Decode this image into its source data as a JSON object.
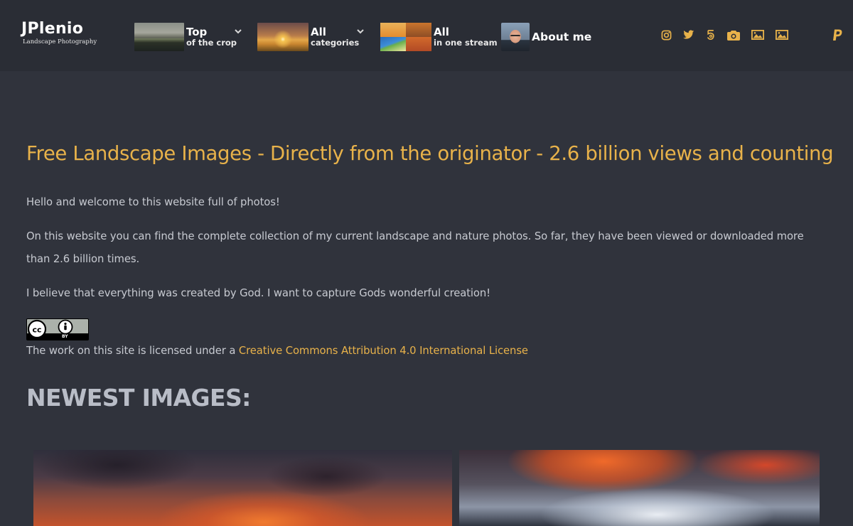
{
  "logo": {
    "title": "JPlenio",
    "subtitle": "Landscape Photography"
  },
  "nav": [
    {
      "main": "Top",
      "sub": "of the crop",
      "has_dropdown": true
    },
    {
      "main": "All",
      "sub": "categories",
      "has_dropdown": true
    },
    {
      "main": "All",
      "sub": "in one stream",
      "has_dropdown": false
    },
    {
      "main": "About me",
      "sub": "",
      "has_dropdown": false
    }
  ],
  "social_icons": [
    "instagram-icon",
    "twitter-icon",
    "500px-icon",
    "camera-icon",
    "image-icon",
    "image-icon",
    "paypal-icon"
  ],
  "colors": {
    "accent": "#e8b24a",
    "background": "#30333c",
    "header": "#2a2d35"
  },
  "main": {
    "headline": "Free Landscape Images - Directly from the originator - 2.6 billion views and counting",
    "para1": "Hello and welcome to this website full of photos!",
    "para2": "On this website you can find the complete collection of my current landscape and nature photos. So far, they have been viewed or downloaded more than 2.6 billion times.",
    "para3": "I believe that everything was created by God. I want to capture Gods wonderful creation!",
    "cc_badge_label": "BY",
    "license_text": "The work on this site is licensed under a",
    "license_link": "Creative Commons Attribution 4.0 International License",
    "newest_title": "NEWEST IMAGES:"
  }
}
